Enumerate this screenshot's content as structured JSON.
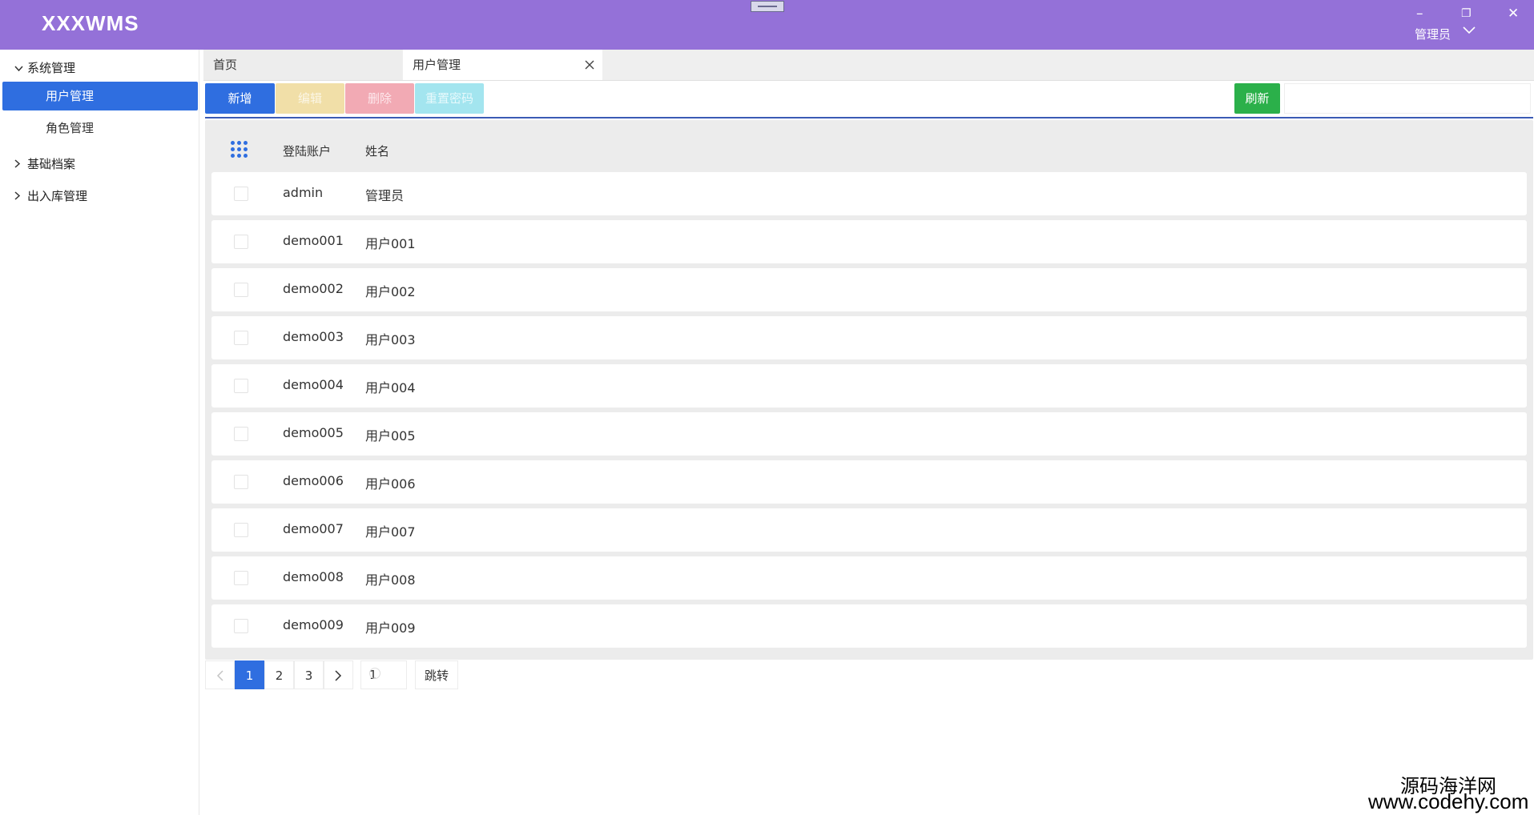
{
  "app": {
    "title": "XXXWMS",
    "user_name": "管理员"
  },
  "window_controls": {
    "minimize": "–",
    "restore": "❐",
    "close": "✕"
  },
  "sidebar": {
    "groups": [
      {
        "label": "系统管理",
        "expanded": true,
        "items": [
          {
            "label": "用户管理",
            "active": true
          },
          {
            "label": "角色管理",
            "active": false
          }
        ]
      },
      {
        "label": "基础档案",
        "expanded": false
      },
      {
        "label": "出入库管理",
        "expanded": false
      }
    ]
  },
  "tabs": [
    {
      "label": "首页",
      "active": false
    },
    {
      "label": "用户管理",
      "active": true,
      "closable": true
    }
  ],
  "toolbar": {
    "add": "新增",
    "edit": "编辑",
    "delete": "删除",
    "reset_password": "重置密码",
    "refresh": "刷新",
    "search_value": ""
  },
  "table": {
    "columns": [
      "登陆账户",
      "姓名"
    ],
    "rows": [
      {
        "account": "admin",
        "name": "管理员"
      },
      {
        "account": "demo001",
        "name": "用户001"
      },
      {
        "account": "demo002",
        "name": "用户002"
      },
      {
        "account": "demo003",
        "name": "用户003"
      },
      {
        "account": "demo004",
        "name": "用户004"
      },
      {
        "account": "demo005",
        "name": "用户005"
      },
      {
        "account": "demo006",
        "name": "用户006"
      },
      {
        "account": "demo007",
        "name": "用户007"
      },
      {
        "account": "demo008",
        "name": "用户008"
      },
      {
        "account": "demo009",
        "name": "用户009"
      }
    ]
  },
  "pagination": {
    "pages": [
      "1",
      "2",
      "3"
    ],
    "current": "1",
    "jump_value": "1",
    "jump_label": "跳转"
  },
  "watermark": {
    "name": "源码海洋网",
    "url": "www.codehy.com"
  },
  "colors": {
    "titlebar": "#9471d8",
    "primary": "#2f6ee0",
    "success": "#2bb04a"
  }
}
